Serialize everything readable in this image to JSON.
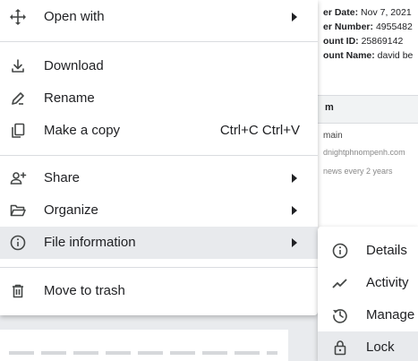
{
  "background": {
    "meta": [
      {
        "label": "er Date:",
        "value": "Nov 7, 2021"
      },
      {
        "label": "er Number:",
        "value": "4955482"
      },
      {
        "label": "ount ID:",
        "value": "25869142"
      },
      {
        "label": "ount Name:",
        "value": "david be"
      }
    ],
    "row_header": "m",
    "line_a": "main",
    "line_b": "dnightphnompenh.com",
    "line_c": "news every 2 years"
  },
  "menu": {
    "open_with": {
      "label": "Open with",
      "icon": "move-arrows-icon"
    },
    "download": {
      "label": "Download",
      "icon": "download-icon"
    },
    "rename": {
      "label": "Rename",
      "icon": "pencil-icon"
    },
    "make_copy": {
      "label": "Make a copy",
      "shortcut": "Ctrl+C Ctrl+V",
      "icon": "copy-icon"
    },
    "share": {
      "label": "Share",
      "icon": "person-add-icon"
    },
    "organize": {
      "label": "Organize",
      "icon": "folder-open-icon"
    },
    "file_information": {
      "label": "File information",
      "icon": "info-icon"
    },
    "move_to_trash": {
      "label": "Move to trash",
      "icon": "trash-icon"
    }
  },
  "submenu": {
    "details": {
      "label": "Details",
      "icon": "info-icon"
    },
    "activity": {
      "label": "Activity",
      "icon": "trend-line-icon"
    },
    "manage": {
      "label": "Manage",
      "icon": "history-icon"
    },
    "lock": {
      "label": "Lock",
      "icon": "lock-icon"
    }
  },
  "colors": {
    "highlight": "#e8eaed",
    "separator": "#dadce0",
    "text": "#202124"
  }
}
